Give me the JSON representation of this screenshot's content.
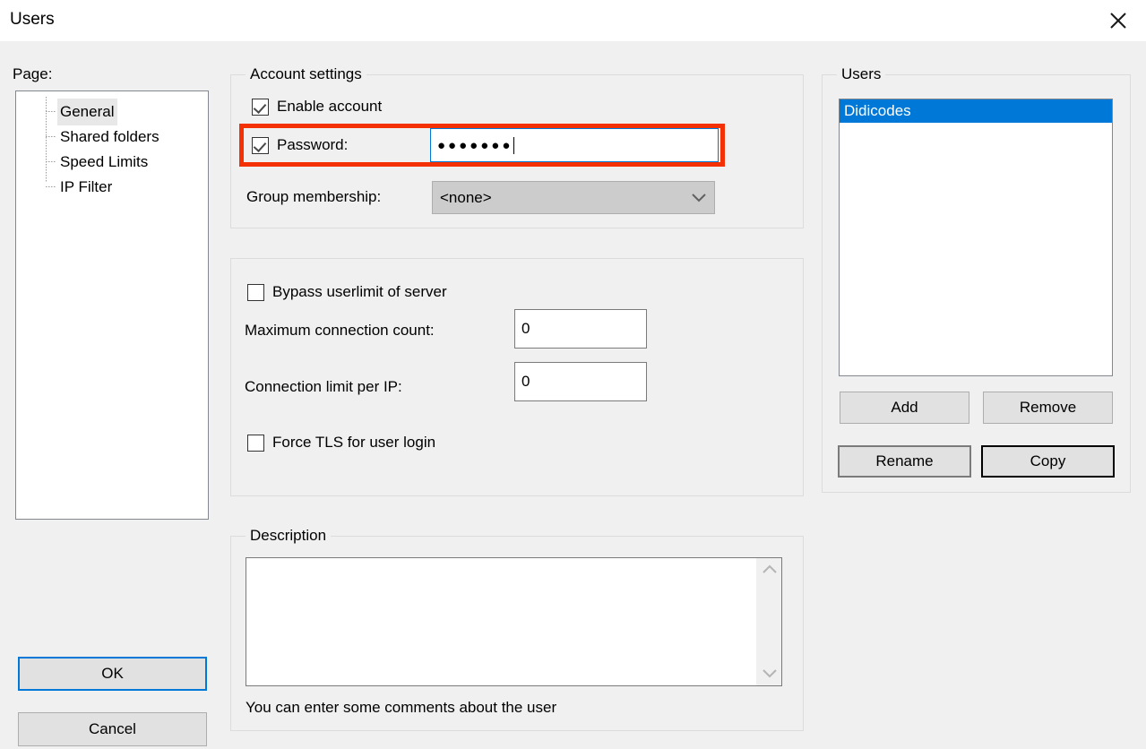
{
  "window": {
    "title": "Users",
    "close_icon": "close-icon"
  },
  "left_panel": {
    "page_label": "Page:",
    "tree_items": [
      {
        "label": "General",
        "selected": true
      },
      {
        "label": "Shared folders",
        "selected": false
      },
      {
        "label": "Speed Limits",
        "selected": false
      },
      {
        "label": "IP Filter",
        "selected": false
      }
    ],
    "ok_label": "OK",
    "cancel_label": "Cancel"
  },
  "account_settings": {
    "legend": "Account settings",
    "enable_account": {
      "label": "Enable account",
      "checked": true
    },
    "password": {
      "label": "Password:",
      "checked": true,
      "value": "●●●●●●●",
      "masked_length": 7,
      "focused": true,
      "highlighted": true
    },
    "group_membership": {
      "label": "Group membership:",
      "value": "<none>",
      "arrow_icon": "chevron-down-icon"
    }
  },
  "limits": {
    "bypass_userlimit": {
      "label": "Bypass userlimit of server",
      "checked": false
    },
    "max_connection_count": {
      "label": "Maximum connection count:",
      "value": "0"
    },
    "connection_limit_per_ip": {
      "label": "Connection limit per IP:",
      "value": "0"
    },
    "force_tls": {
      "label": "Force TLS for user login",
      "checked": false
    }
  },
  "description": {
    "legend": "Description",
    "value": "",
    "hint": "You can enter some comments about the user",
    "scroll_up_icon": "chevron-up-icon",
    "scroll_down_icon": "chevron-down-icon"
  },
  "users_panel": {
    "legend": "Users",
    "items": [
      {
        "label": "Didicodes",
        "selected": true
      }
    ],
    "buttons": {
      "add": "Add",
      "remove": "Remove",
      "rename": "Rename",
      "copy": "Copy"
    }
  },
  "colors": {
    "window_background": "#f0f0f0",
    "titlebar_background": "#ffffff",
    "selection_blue": "#0078d7",
    "annotation_red": "#f43005",
    "button_face": "#e1e1e1",
    "groupbox_border": "#dcdcdc",
    "field_border": "#7a7a7a"
  }
}
